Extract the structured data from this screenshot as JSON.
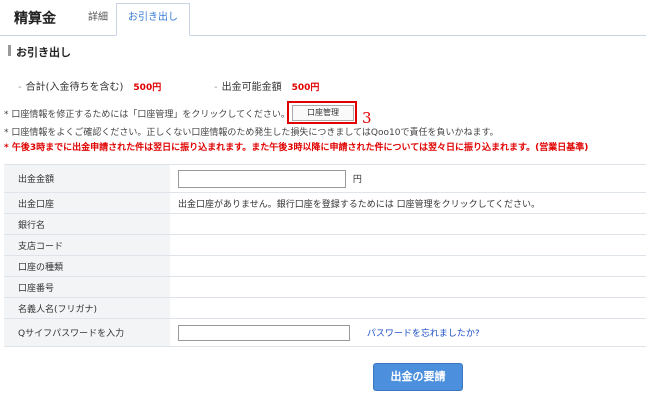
{
  "header": {
    "title": "精算金",
    "tabs": [
      {
        "label": "詳細",
        "active": false
      },
      {
        "label": "お引き出し",
        "active": true
      }
    ]
  },
  "section": {
    "title": "お引き出し"
  },
  "summary": {
    "total_label": "合計(入金待ちを含む)",
    "total_amount": "500円",
    "available_label": "出金可能金額",
    "available_amount": "500円"
  },
  "notes": {
    "note1": "* 口座情報を修正するためには「口座管理」をクリックしてください。",
    "account_mgmt_button": "口座管理",
    "annotation": "3",
    "note2": "* 口座情報をよくご確認ください。正しくない口座情報のため発生した損失につきましてはQoo10で責任を負いかねます。",
    "note3": "* 午後3時までに出金申請された件は翌日に振り込まれます。また午後3時以降に申請された件については翌々日に振り込まれます。(営業日基準)"
  },
  "form": {
    "amount_label": "出金金額",
    "amount_value": "",
    "amount_unit": "円",
    "account_label": "出金口座",
    "account_value": "出金口座がありません。銀行口座を登録するためには 口座管理をクリックしてください。",
    "bank_label": "銀行名",
    "branch_label": "支店コード",
    "account_type_label": "口座の種類",
    "account_number_label": "口座番号",
    "holder_label": "名義人名(フリガナ)",
    "password_label": "Qサイフパスワードを入力",
    "password_value": "",
    "forgot_link": "パスワードを忘れましたか?"
  },
  "actions": {
    "submit_label": "出金の要請"
  },
  "colors": {
    "accent": "#4c8fdc",
    "warning": "#e00000",
    "link": "#1c4fc4"
  }
}
